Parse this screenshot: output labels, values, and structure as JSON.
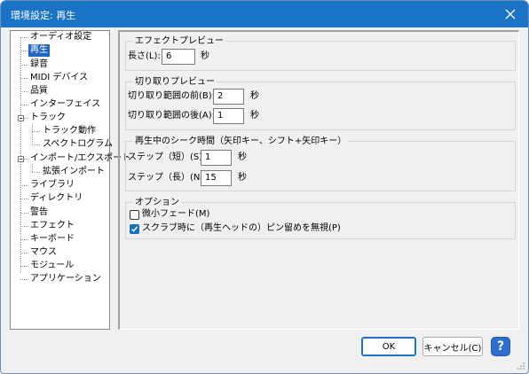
{
  "window": {
    "title": "環境設定: 再生"
  },
  "tree": {
    "items": [
      {
        "label": "オーディオ設定"
      },
      {
        "label": "再生"
      },
      {
        "label": "録音"
      },
      {
        "label": "MIDI デバイス"
      },
      {
        "label": "品質"
      },
      {
        "label": "インターフェイス"
      },
      {
        "label": "トラック"
      },
      {
        "label": "トラック動作"
      },
      {
        "label": "スペクトログラム"
      },
      {
        "label": "インポート/エクスポート"
      },
      {
        "label": "拡張インポート"
      },
      {
        "label": "ライブラリ"
      },
      {
        "label": "ディレクトリ"
      },
      {
        "label": "警告"
      },
      {
        "label": "エフェクト"
      },
      {
        "label": "キーボード"
      },
      {
        "label": "マウス"
      },
      {
        "label": "モジュール"
      },
      {
        "label": "アプリケーション"
      }
    ]
  },
  "effect_preview": {
    "legend": "エフェクトプレビュー",
    "length_label": "長さ(L):",
    "length_value": "6",
    "unit": "秒"
  },
  "cut_preview": {
    "legend": "切り取りプレビュー",
    "before_label": "切り取り範囲の前(B):",
    "before_value": "2",
    "after_label": "切り取り範囲の後(A):",
    "after_value": "1",
    "unit": "秒"
  },
  "seek": {
    "legend": "再生中のシーク時間（矢印キー、シフト+矢印キー）",
    "short_label": "ステップ（短）(S):",
    "short_value": "1",
    "long_label": "ステップ（長）(N):",
    "long_value": "15",
    "unit": "秒"
  },
  "options": {
    "legend": "オプション",
    "micro_fade_label": "微小フェード(M)",
    "micro_fade_checked": false,
    "scrub_pin_label": "スクラブ時に（再生ヘッドの）ピン留めを無視(P)",
    "scrub_pin_checked": true
  },
  "buttons": {
    "ok": "OK",
    "cancel": "キャンセル(C)",
    "help": "?"
  },
  "colors": {
    "titlebar": "#1a73c5",
    "selection": "#2266c4",
    "checkbox_on": "#1a6fc4"
  }
}
